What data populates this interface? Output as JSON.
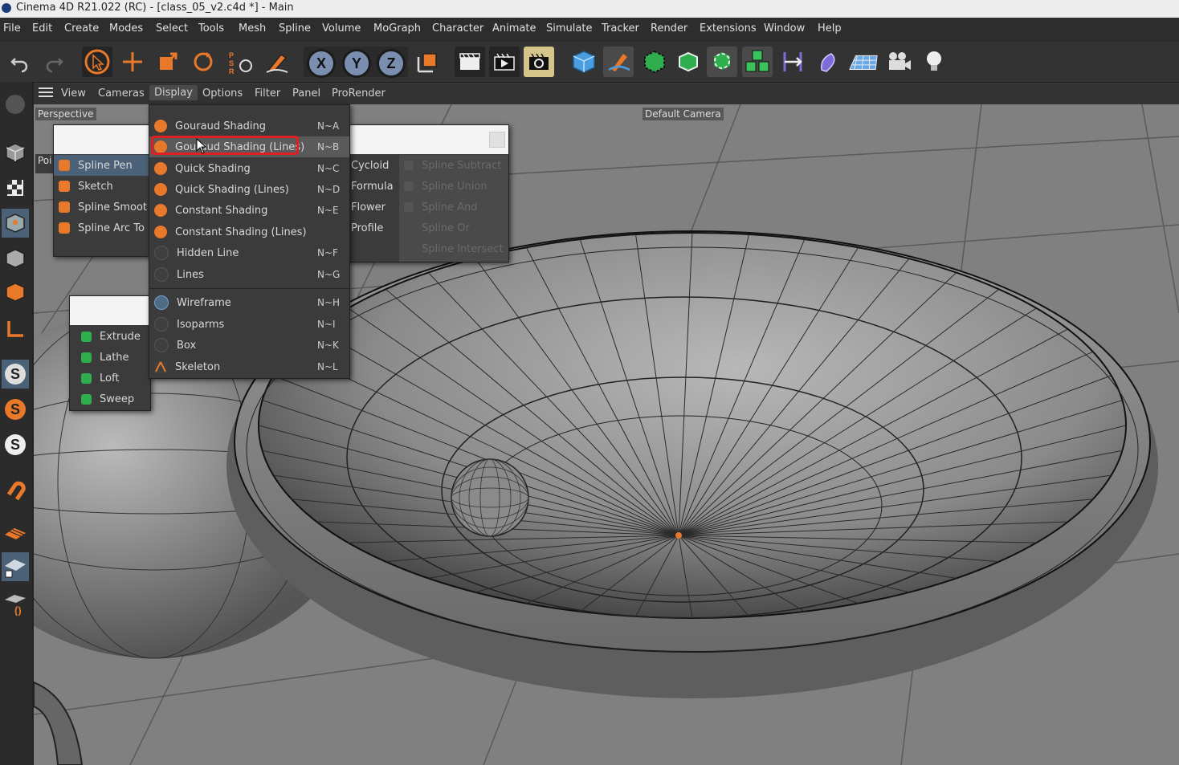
{
  "window": {
    "title": "Cinema 4D R21.022 (RC) - [class_05_v2.c4d *] - Main"
  },
  "menubar": [
    "File",
    "Edit",
    "Create",
    "Modes",
    "Select",
    "Tools",
    "Mesh",
    "Spline",
    "Volume",
    "MoGraph",
    "Character",
    "Animate",
    "Simulate",
    "Tracker",
    "Render",
    "Extensions",
    "Window",
    "Help"
  ],
  "toolbar": {
    "axis_x": "X",
    "axis_y": "Y",
    "axis_z": "Z",
    "icons": [
      "undo-icon",
      "redo-icon",
      "move-select-icon",
      "move-icon",
      "scale-icon",
      "rotate-icon",
      "psr-icon",
      "spline-pen-icon",
      "lock-x-icon",
      "lock-y-icon",
      "lock-z-icon",
      "coordinate-system-icon",
      "render-region-icon",
      "render-view-icon",
      "render-settings-icon",
      "cube-icon",
      "pen-tool-icon",
      "subdivision-icon",
      "extrude-icon",
      "mograph-cloner-icon",
      "array-icon",
      "deformer-icon",
      "sweep-icon",
      "floor-icon",
      "camera-icon",
      "light-icon"
    ]
  },
  "viewport_menu": {
    "items": [
      "View",
      "Cameras",
      "Display",
      "Options",
      "Filter",
      "Panel",
      "ProRender"
    ],
    "active": "Display"
  },
  "viewport": {
    "view_name": "Perspective",
    "camera_label": "Default Camera",
    "side_tab": "Poi"
  },
  "display_menu": {
    "items": [
      {
        "label": "Gouraud Shading",
        "shortcut": "N~A"
      },
      {
        "label": "Gouraud Shading (Lines)",
        "shortcut": "N~B"
      },
      {
        "label": "Quick Shading",
        "shortcut": "N~C"
      },
      {
        "label": "Quick Shading (Lines)",
        "shortcut": "N~D"
      },
      {
        "label": "Constant Shading",
        "shortcut": "N~E"
      },
      {
        "label": "Constant Shading (Lines)",
        "shortcut": ""
      },
      {
        "label": "Hidden Line",
        "shortcut": "N~F"
      },
      {
        "label": "Lines",
        "shortcut": "N~G"
      },
      {
        "label": "Wireframe",
        "shortcut": "N~H"
      },
      {
        "label": "Isoparms",
        "shortcut": "N~I"
      },
      {
        "label": "Box",
        "shortcut": "N~K"
      },
      {
        "label": "Skeleton",
        "shortcut": "N~L"
      }
    ],
    "highlighted": "Gouraud Shading (Lines)"
  },
  "spline_pen_menu": [
    "Spline Pen",
    "Sketch",
    "Spline Smoot",
    "Spline Arc To"
  ],
  "spline_prim_menu": [
    "Cycloid",
    "Formula",
    "Flower",
    "Profile"
  ],
  "spline_bool_menu": [
    "Spline Subtract",
    "Spline Union",
    "Spline And",
    "Spline Or",
    "Spline Intersect"
  ],
  "generator_menu": [
    "Extrude",
    "Lathe",
    "Loft",
    "Sweep"
  ],
  "colors": {
    "accent_orange": "#e8782a",
    "highlight_red": "#e02020",
    "selection_blue": "#4b6178"
  }
}
